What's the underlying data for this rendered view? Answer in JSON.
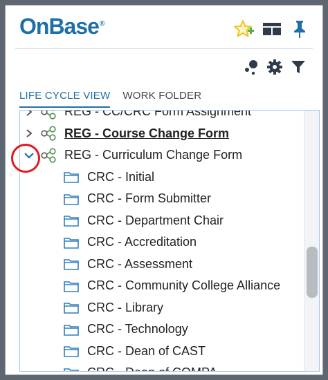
{
  "header": {
    "logo_text": "OnBase",
    "logo_tm": "®",
    "icons": [
      "star-add-icon",
      "layout-icon",
      "pin-icon"
    ]
  },
  "toolbar": {
    "icons": [
      "workflow-actions-icon",
      "gear-icon",
      "filter-icon"
    ]
  },
  "tabs": [
    {
      "label": "LIFE CYCLE VIEW",
      "active": true
    },
    {
      "label": "WORK FOLDER",
      "active": false
    }
  ],
  "tree": {
    "partial_top_label": "REG - CC/CRC Form Assignment",
    "lifecycles": [
      {
        "label": "REG - Course Change Form",
        "expanded": false,
        "selected": true
      },
      {
        "label": "REG - Curriculum Change Form",
        "expanded": true,
        "selected": false
      }
    ],
    "queues": [
      "CRC - Initial",
      "CRC - Form Submitter",
      "CRC - Department Chair",
      "CRC - Accreditation",
      "CRC - Assessment",
      "CRC - Community College Alliance",
      "CRC - Library",
      "CRC - Technology",
      "CRC - Dean of CAST",
      "CRC - Dean of COMPA"
    ]
  },
  "colors": {
    "brand_blue": "#1f6fa8",
    "star_yellow": "#f2c21b",
    "add_green": "#4caf50",
    "annotation_red": "#e0191f",
    "frame_gray": "#5d6671"
  }
}
